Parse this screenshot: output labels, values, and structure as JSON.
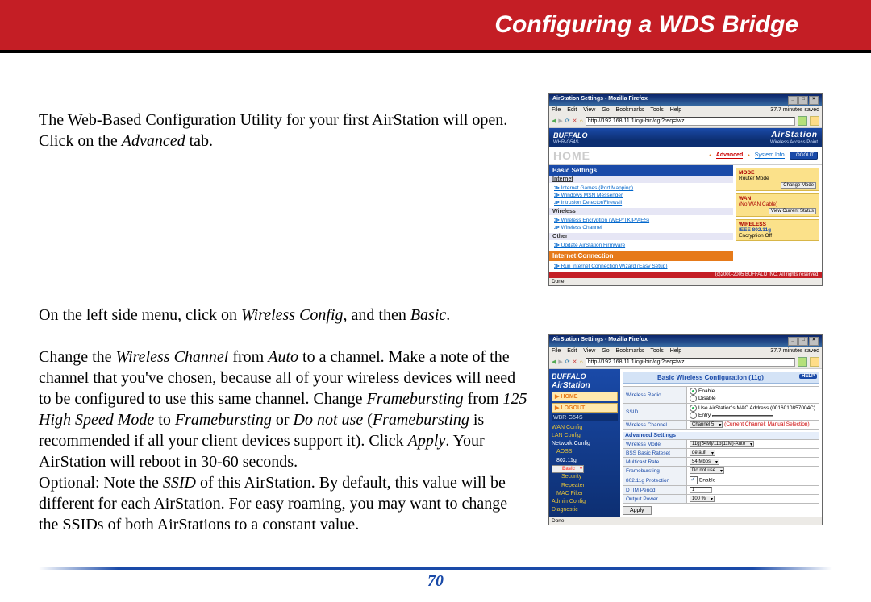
{
  "header": {
    "title": "Configuring a WDS Bridge"
  },
  "page_number": "70",
  "para1": {
    "t1": "The Web-Based Configuration Utility for your first AirStation will open.  Click on the ",
    "i1": "Advanced",
    "t2": " tab."
  },
  "para2": {
    "l1a": "On the left side menu, click on ",
    "l1i1": "Wireless Config",
    "l1b": ", and then ",
    "l1i2": "Basic",
    "l1c": ".",
    "l2a": "Change the ",
    "l2i1": "Wireless Channel",
    "l2b": " from ",
    "l2i2": "Auto",
    "l2c": " to a channel.  Make a note of the channel that you've chosen, because all of your wireless devices will need to be configured to use this same channel.  Change ",
    "l2i3": "Framebursting",
    "l2d": " from ",
    "l2i4": "125 High Speed Mode",
    "l2e": " to ",
    "l2i5": "Framebursting",
    "l2f": " or ",
    "l2i6": "Do not use",
    "l2g": " (",
    "l2i7": "Framebursting",
    "l2h": " is recommended if all your client devices support it).  Click ",
    "l2i8": "Apply",
    "l2j": ".  Your AirStation will reboot in 30-60 seconds.",
    "l3a": "Optional:  Note the ",
    "l3i1": "SSID",
    "l3b": " of this AirStation.  By default, this value will be different for each AirStation.  For easy roaming, you may want to change the SSIDs of both AirStations to a constant value."
  },
  "shot1": {
    "title": "AirStation Settings - Mozilla Firefox",
    "saved": "37.7 minutes saved",
    "menu": [
      "File",
      "Edit",
      "View",
      "Go",
      "Bookmarks",
      "Tools",
      "Help"
    ],
    "url": "http://192.168.11.1/cgi-bin/cgi?req=twz",
    "brand": "BUFFALO",
    "model": "WHR-G54S",
    "air": "AirStation",
    "wap": "Wireless Access Point",
    "home": "HOME",
    "adv": "Advanced",
    "sys": "System Info",
    "logout": "LOGOUT",
    "basic_settings": "Basic Settings",
    "internet": "Internet",
    "links_internet": [
      "Internet Games (Port Mapping)",
      "Windows MSN Messenger",
      "Intrusion Detector/Firewall"
    ],
    "wireless": "Wireless",
    "links_wireless": [
      "Wireless Encryption (WEP/TKIP/AES)",
      "Wireless Channel"
    ],
    "other": "Other",
    "links_other": [
      "Update AirStation Firmware"
    ],
    "internet_conn": "Internet Connection",
    "links_conn": [
      "Run Internet Connection Wizard (Easy Setup)"
    ],
    "mode_hdr": "MODE",
    "mode_val": "Router Mode",
    "mode_btn": "Change Mode",
    "wan_hdr": "WAN",
    "wan_val": "(No WAN Cable)",
    "wan_btn": "View Current Status",
    "wl_hdr": "WIRELESS",
    "wl_val": "IEEE 802.11g",
    "wl_enc": "Encryption   Off",
    "footer": "(c)2000-2005 BUFFALO INC. All rights reserved.",
    "status": "Done"
  },
  "shot2": {
    "title": "AirStation Settings - Mozilla Firefox",
    "saved": "37.7 minutes saved",
    "menu": [
      "File",
      "Edit",
      "View",
      "Go",
      "Bookmarks",
      "Tools",
      "Help"
    ],
    "url": "http://192.168.11.1/cgi-bin/cgi?req=twz",
    "brand": "BUFFALO",
    "air": "AirStation",
    "home": "HOME",
    "logout": "LOGOUT",
    "model": "WBR-G54S",
    "tree": {
      "wan": "WAN Config",
      "lan": "LAN Config",
      "net": "Network Config",
      "aoss": "AOSS",
      "g": "802.11g",
      "basic": "Basic",
      "sec": "Security",
      "rep": "Repeater",
      "mac": "MAC Filter",
      "admin": "Admin Config",
      "diag": "Diagnostic"
    },
    "cfg_title": "Basic Wireless Configuration (11g)",
    "help": "HELP",
    "rows": {
      "wr": {
        "k": "Wireless Radio",
        "v1": "Enable",
        "v2": "Disable"
      },
      "ssid": {
        "k": "SSID",
        "opt": "Use AirStation's MAC Address (0016010857004C)",
        "entry": "Entry",
        "entry_val": ""
      },
      "ch": {
        "k": "Wireless Channel",
        "v": "Channel 5",
        "note": "(Current Channel: Manual Selection)"
      },
      "adv": "Advanced Settings",
      "wm": {
        "k": "Wireless Mode",
        "v": "11g(54M)/11b(11M)-Auto"
      },
      "br": {
        "k": "BSS Basic Rateset",
        "v": "default"
      },
      "mr": {
        "k": "Multicast Rate",
        "v": "54 Mbps"
      },
      "fb": {
        "k": "Framebursting",
        "v": "Do not use"
      },
      "pr": {
        "k": "802.11g Protection",
        "v": "Enable"
      },
      "dt": {
        "k": "DTIM Period",
        "v": "1"
      },
      "op": {
        "k": "Output Power",
        "v": "100 %"
      }
    },
    "apply": "Apply",
    "status": "Done"
  }
}
